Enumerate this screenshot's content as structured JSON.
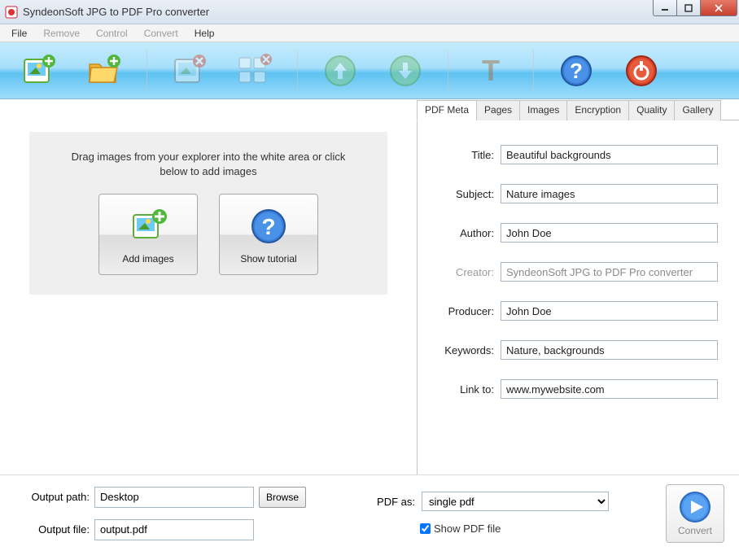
{
  "window": {
    "title": "SyndeonSoft JPG to PDF Pro converter"
  },
  "menu": {
    "file": "File",
    "remove": "Remove",
    "control": "Control",
    "convert": "Convert",
    "help": "Help"
  },
  "toolbar_icons": {
    "add_image": "add-image-icon",
    "add_folder": "add-folder-icon",
    "remove_image": "remove-image-icon",
    "remove_all": "remove-all-icon",
    "move_up": "arrow-up-icon",
    "move_down": "arrow-down-icon",
    "text": "text-icon",
    "help": "help-icon",
    "power": "power-icon"
  },
  "dropzone": {
    "hint": "Drag images from your explorer into the white area or click below to add images",
    "add_images": "Add images",
    "show_tutorial": "Show tutorial"
  },
  "tabs": [
    "PDF Meta",
    "Pages",
    "Images",
    "Encryption",
    "Quality",
    "Gallery"
  ],
  "active_tab": 0,
  "meta": {
    "labels": {
      "title": "Title:",
      "subject": "Subject:",
      "author": "Author:",
      "creator": "Creator:",
      "producer": "Producer:",
      "keywords": "Keywords:",
      "link": "Link to:"
    },
    "title": "Beautiful backgrounds",
    "subject": "Nature images",
    "author": "John Doe",
    "creator": "SyndeonSoft JPG to PDF Pro converter",
    "producer": "John Doe",
    "keywords": "Nature, backgrounds",
    "link": "www.mywebsite.com"
  },
  "output": {
    "path_label": "Output path:",
    "path": "Desktop",
    "browse": "Browse",
    "file_label": "Output file:",
    "file": "output.pdf",
    "pdf_as_label": "PDF as:",
    "pdf_as": "single pdf",
    "show_pdf": "Show PDF file",
    "show_pdf_checked": true,
    "convert": "Convert"
  }
}
